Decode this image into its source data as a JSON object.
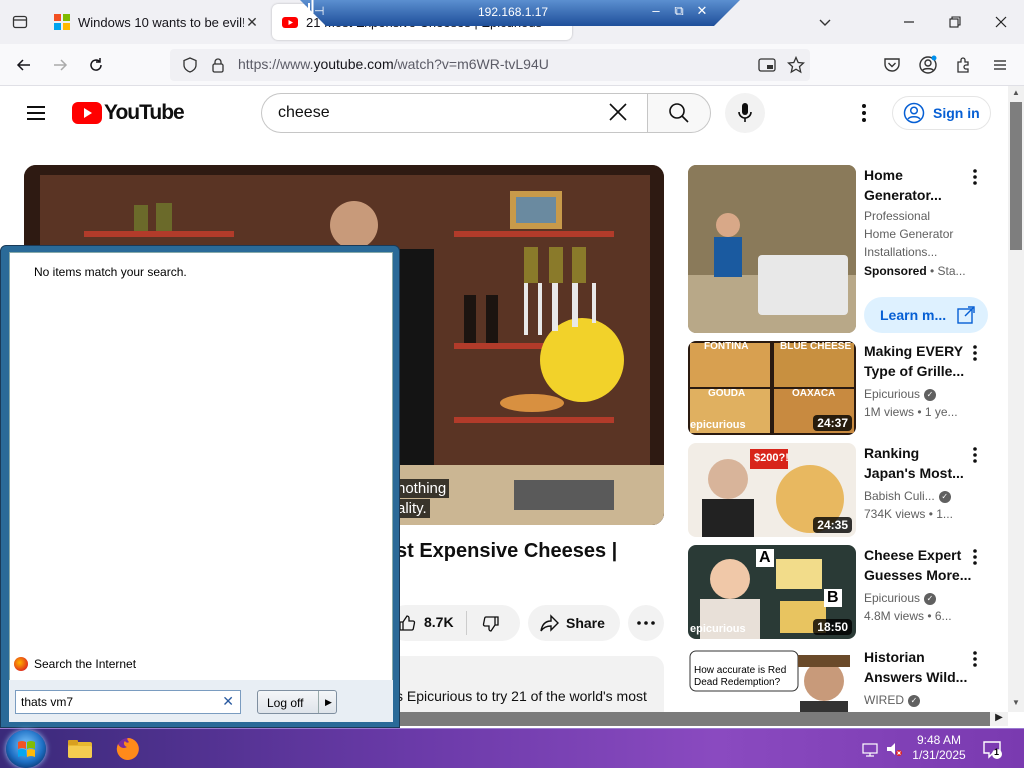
{
  "browser": {
    "tabs": [
      {
        "title": "Windows 10 wants to be evil! | I",
        "active": false
      },
      {
        "title": "21 Most Expensive Cheeses | Epicurious",
        "active": true
      }
    ],
    "url_prefix": "https://www.",
    "url_domain": "youtube.com",
    "url_path": "/watch?v=m6WR-tvL94U"
  },
  "remote_bar": {
    "host": "192.168.1.17"
  },
  "youtube": {
    "logo_text": "YouTube",
    "search_query": "cheese",
    "sign_in_label": "Sign in",
    "video": {
      "captions": [
        "nothing",
        "ality."
      ],
      "title": "st Expensive Cheeses |",
      "likes": "8.7K",
      "share_label": "Share",
      "description_snippet": "s Epicurious to try 21 of the world's most"
    },
    "recommendations": [
      {
        "title": "Home Generator...",
        "channel_lines": [
          "Professional",
          "Home Generator",
          "Installations..."
        ],
        "meta": "Sponsored",
        "meta_tail": "Sta...",
        "cta": "Learn m...",
        "duration": ""
      },
      {
        "title_lines": [
          "Making EVERY",
          "Type of Grille..."
        ],
        "channel": "Epicurious",
        "verified": true,
        "meta": "1M views  •  1 ye...",
        "duration": "24:37",
        "thumb_labels": [
          "FONTINA",
          "BLUE CHEESE",
          "GOUDA",
          "OAXACA",
          "epicurious"
        ]
      },
      {
        "title_lines": [
          "Ranking",
          "Japan's Most..."
        ],
        "channel": "Babish Culi...",
        "verified": true,
        "meta": "734K views  •  1...",
        "duration": "24:35",
        "thumb_labels": [
          "$200?!"
        ]
      },
      {
        "title_lines": [
          "Cheese Expert",
          "Guesses More..."
        ],
        "channel": "Epicurious",
        "verified": true,
        "meta": "4.8M views  •  6...",
        "duration": "18:50",
        "thumb_labels": [
          "A",
          "B",
          "epicurious"
        ]
      },
      {
        "title_lines": [
          "Historian",
          "Answers Wild..."
        ],
        "channel": "WIRED",
        "verified": true,
        "meta": "",
        "duration": "",
        "thumb_labels": [
          "How accurate is Red",
          "Dead Redemption?"
        ]
      }
    ]
  },
  "start_menu": {
    "empty_message": "No items match your search.",
    "search_internet_label": "Search the Internet",
    "search_value": "thats vm7",
    "logoff_label": "Log off"
  },
  "taskbar": {
    "time": "9:48 AM",
    "date": "1/31/2025",
    "notification_count": "1"
  },
  "colors": {
    "yt_red": "#ff0000",
    "link_blue": "#065fd4",
    "taskbar_purple": "#6a3aa8",
    "startmenu_frame": "#2a6a98"
  }
}
